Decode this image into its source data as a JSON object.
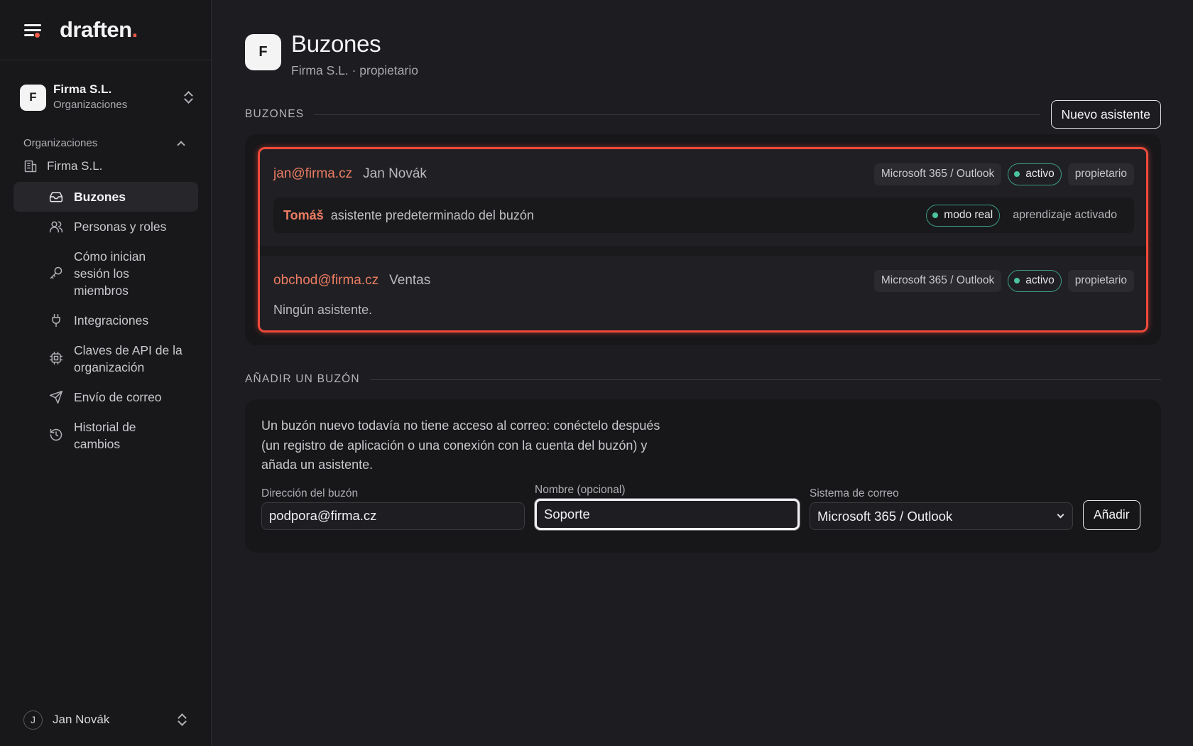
{
  "app": {
    "logo": "draften",
    "logo_dot": "."
  },
  "org_switcher": {
    "avatar": "F",
    "name": "Firma S.L.",
    "subtitle": "Organizaciones"
  },
  "sidebar": {
    "section_label": "Organizaciones",
    "org_name": "Firma S.L.",
    "items": [
      {
        "label": "Buzones",
        "icon": "inbox-icon",
        "active": true
      },
      {
        "label": "Personas y roles",
        "icon": "users-icon"
      },
      {
        "label": "Cómo inician sesión los miembros",
        "icon": "key-icon"
      },
      {
        "label": "Integraciones",
        "icon": "plug-icon"
      },
      {
        "label": "Claves de API de la organización",
        "icon": "chip-icon"
      },
      {
        "label": "Envío de correo",
        "icon": "send-icon"
      },
      {
        "label": "Historial de cambios",
        "icon": "history-icon"
      }
    ],
    "user": {
      "avatar": "J",
      "name": "Jan Novák"
    }
  },
  "header": {
    "avatar": "F",
    "title": "Buzones",
    "subtitle": "Firma S.L. · propietario"
  },
  "mailboxes_section": {
    "title": "BUZONES",
    "new_button": "Nuevo asistente",
    "mailboxes": [
      {
        "email": "jan@firma.cz",
        "name": "Jan Novák",
        "provider": "Microsoft 365 / Outlook",
        "status": "activo",
        "role": "propietario",
        "assistant": {
          "name": "Tomáš",
          "description": "asistente predeterminado del buzón",
          "mode": "modo real",
          "learning": "aprendizaje activado"
        }
      },
      {
        "email": "obchod@firma.cz",
        "name": "Ventas",
        "provider": "Microsoft 365 / Outlook",
        "status": "activo",
        "role": "propietario",
        "no_assistant": "Ningún asistente."
      }
    ]
  },
  "add_section": {
    "title": "AÑADIR UN BUZÓN",
    "description": "Un buzón nuevo todavía no tiene acceso al correo: conéctelo después (un registro de aplicación o una conexión con la cuenta del buzón) y añada un asistente.",
    "address_label": "Dirección del buzón",
    "address_value": "podpora@firma.cz",
    "name_label": "Nombre (opcional)",
    "name_value": "Soporte",
    "system_label": "Sistema de correo",
    "system_value": "Microsoft 365 / Outlook",
    "add_button": "Añadir"
  },
  "colors": {
    "accent": "#ec7c62",
    "highlight": "#f04a3a",
    "status": "#4cc29d"
  }
}
